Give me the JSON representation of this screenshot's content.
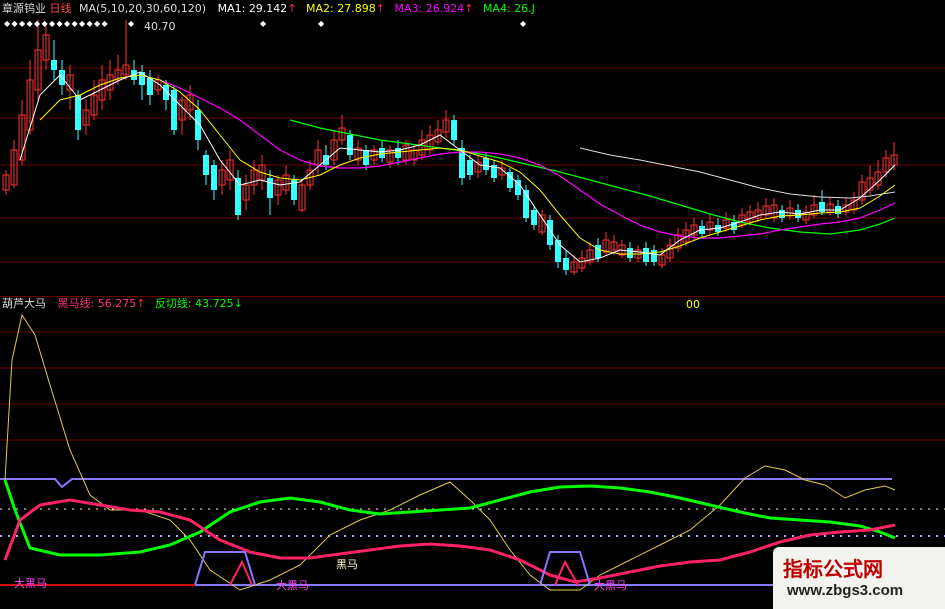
{
  "main_panel": {
    "stock_name": "章源钨业",
    "period": "日线",
    "ma_label": "MA(5,10,20,30,60,120)",
    "ma1": {
      "label": "MA1:",
      "value": "29.142",
      "color": "#ffffff"
    },
    "ma2": {
      "label": "MA2:",
      "value": "27.898",
      "color": "#ffff00"
    },
    "ma3": {
      "label": "MA3:",
      "value": "26.924",
      "color": "#ff00ff"
    },
    "ma4": {
      "label": "MA4:",
      "value": "26.J",
      "color": "#00ff00"
    },
    "peak_label": "40.70",
    "right_mark": "00"
  },
  "indicator_panel": {
    "name": "葫芦大马",
    "line1": {
      "label": "黑马线:",
      "value": "56.275",
      "color": "#ff3377"
    },
    "line2": {
      "label": "反切线:",
      "value": "43.725",
      "color": "#00ff00"
    },
    "annotations": {
      "big_black_horse": "大黑马",
      "black_horse": "黑马"
    }
  },
  "watermark": {
    "title": "指标公式网",
    "url": "www.zbgs3.com"
  },
  "colors": {
    "up": "#ff3333",
    "down": "#33ffff",
    "ma5": "#ffffff",
    "ma10": "#ffff00",
    "ma20": "#ff00ff",
    "ma30": "#00ff00",
    "grid": "#6a0000"
  }
}
